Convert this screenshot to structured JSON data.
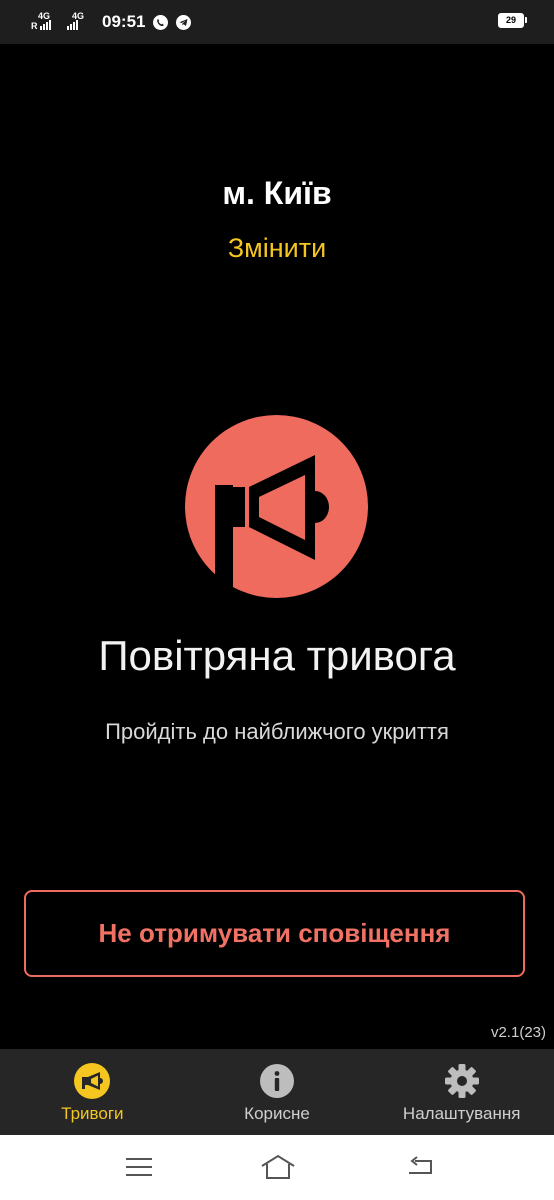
{
  "status_bar": {
    "network_1": "4G",
    "roaming": "R",
    "network_2": "4G",
    "time": "09:51",
    "battery": "29",
    "icons": [
      "viber-icon",
      "telegram-icon"
    ]
  },
  "location": {
    "city": "м. Київ",
    "change_label": "Змінити"
  },
  "alert": {
    "icon": "megaphone-icon",
    "title": "Повітряна тривога",
    "subtitle": "Пройдіть до найближчого укриття"
  },
  "actions": {
    "mute_label": "Не отримувати сповіщення"
  },
  "version": "v2.1(23)",
  "tabs": [
    {
      "label": "Тривоги",
      "icon": "megaphone-icon",
      "active": true
    },
    {
      "label": "Корисне",
      "icon": "info-icon",
      "active": false
    },
    {
      "label": "Налаштування",
      "icon": "gear-icon",
      "active": false
    }
  ],
  "colors": {
    "background": "#000000",
    "accent_yellow": "#f5c61f",
    "alert_red": "#ef6b5d",
    "tab_bar": "#262626"
  }
}
